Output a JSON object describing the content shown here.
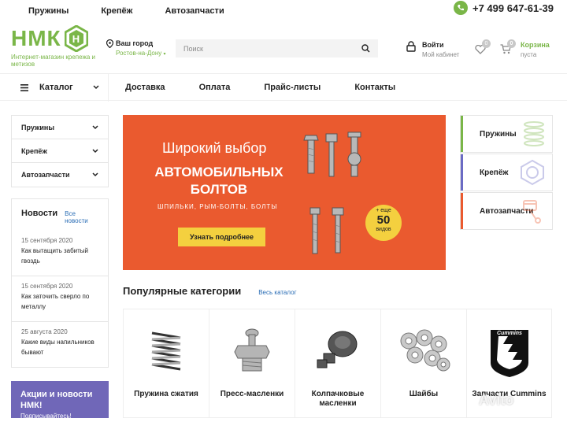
{
  "topbar": {
    "links": [
      "Пружины",
      "Крепёж",
      "Автозапчасти"
    ],
    "phone": "+7 499 647-61-39"
  },
  "header": {
    "logo_text": "НМК",
    "logo_subtitle": "Интернет-магазин крепежа и метизов",
    "city_label": "Ваш город",
    "city_value": "Ростов-на-Дону",
    "search_placeholder": "Поиск",
    "login_label": "Войти",
    "login_sub": "Мой кабинет",
    "fav_count": "0",
    "cart_count": "0",
    "cart_label": "Корзина",
    "cart_sub": "пуста"
  },
  "nav": {
    "catalog": "Каталог",
    "links": [
      "Доставка",
      "Оплата",
      "Прайс-листы",
      "Контакты"
    ]
  },
  "sidebar": {
    "menu": [
      "Пружины",
      "Крепёж",
      "Автозапчасти"
    ]
  },
  "news": {
    "title": "Новости",
    "all_link": "Все новости",
    "items": [
      {
        "date": "15 сентября 2020",
        "text": "Как вытащить забитый гвоздь"
      },
      {
        "date": "15 сентября 2020",
        "text": "Как заточить сверло по металлу"
      },
      {
        "date": "25 августа 2020",
        "text": "Какие виды напильников бывают"
      }
    ]
  },
  "promo": {
    "title": "Акции и новости НМК!",
    "sub": "Подписывайтесь!"
  },
  "banner": {
    "line1": "Широкий выбор",
    "line2": "АВТОМОБИЛЬНЫХ БОЛТОВ",
    "line3": "ШПИЛЬКИ, РЫМ-БОЛТЫ, БОЛТЫ",
    "button": "Узнать подробнее",
    "badge_prefix": "+ еще",
    "badge_number": "50",
    "badge_suffix": "видов",
    "color": "#ea5a2f"
  },
  "category_tiles": [
    {
      "label": "Пружины",
      "color": "#7ab648",
      "icon": "spring-icon"
    },
    {
      "label": "Крепёж",
      "color": "#6b6bc4",
      "icon": "nut-icon"
    },
    {
      "label": "Автозапчасти",
      "color": "#ea5a2f",
      "icon": "piston-icon"
    }
  ],
  "popular": {
    "title": "Популярные категории",
    "all_link": "Весь каталог",
    "items": [
      {
        "label": "Пружина сжатия",
        "icon": "spring-icon"
      },
      {
        "label": "Пресс-масленки",
        "icon": "grease-fitting-icon"
      },
      {
        "label": "Колпачковые масленки",
        "icon": "cap-oiler-icon"
      },
      {
        "label": "Шайбы",
        "icon": "washers-icon"
      },
      {
        "label": "Запчасти Cummins",
        "icon": "cummins-logo"
      }
    ]
  },
  "watermark": "Avito",
  "brand_green": "#7ab648",
  "link_blue": "#2a6db5"
}
